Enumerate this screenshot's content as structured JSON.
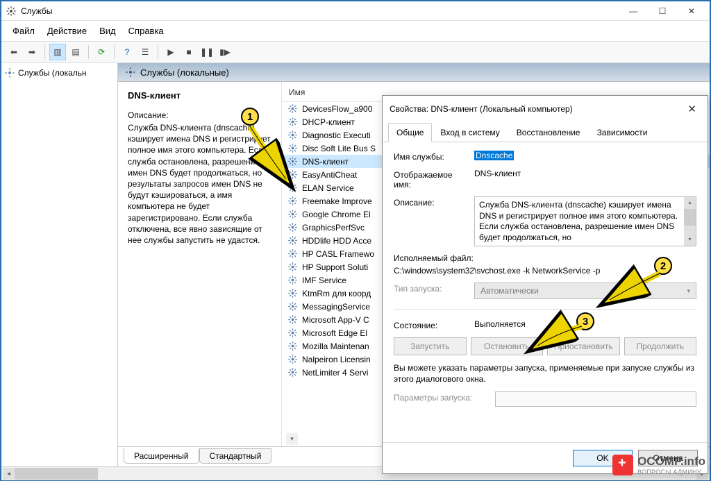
{
  "window": {
    "title": "Службы"
  },
  "menu": {
    "file": "Файл",
    "action": "Действие",
    "view": "Вид",
    "help": "Справка"
  },
  "nav": {
    "local_services": "Службы (локальн"
  },
  "center": {
    "header": "Службы (локальные)",
    "selected_name": "DNS-клиент",
    "desc_label": "Описание:",
    "desc_text": "Служба DNS-клиента (dnscache) кэширует имена DNS и регистрирует полное имя этого компьютера. Если служба остановлена, разрешение имен DNS будет продолжаться, но результаты запросов имен DNS не будут кэшироваться, а имя компьютера не будет зарегистрировано. Если служба отключена, все явно зависящие от нее службы запустить не удастся.",
    "column_name": "Имя",
    "tabs": {
      "extended": "Расширенный",
      "standard": "Стандартный"
    },
    "items": [
      "DevicesFlow_a900",
      "DHCP-клиент",
      "Diagnostic Executi",
      "Disc Soft Lite Bus S",
      "DNS-клиент",
      "EasyAntiCheat",
      "ELAN Service",
      "Freemake Improve",
      "Google Chrome El",
      "GraphicsPerfSvc",
      "HDDlife HDD Acce",
      "HP CASL Framewo",
      "HP Support Soluti",
      "IMF Service",
      "KtmRm для коорд",
      "MessagingService",
      "Microsoft App-V C",
      "Microsoft Edge El",
      "Mozilla Maintenan",
      "Nalpeiron Licensin",
      "NetLimiter 4 Servi"
    ],
    "selected_index": 4
  },
  "dialog": {
    "title": "Свойства: DNS-клиент (Локальный компьютер)",
    "tabs": {
      "general": "Общие",
      "logon": "Вход в систему",
      "recovery": "Восстановление",
      "deps": "Зависимости"
    },
    "labels": {
      "service_name": "Имя службы:",
      "display_name": "Отображаемое имя:",
      "description": "Описание:",
      "exe": "Исполняемый файл:",
      "startup": "Тип запуска:",
      "state": "Состояние:",
      "params": "Параметры запуска:"
    },
    "values": {
      "service_name": "Dnscache",
      "display_name": "DNS-клиент",
      "description": "Служба DNS-клиента (dnscache) кэширует имена DNS и регистрирует полное имя этого компьютера. Если служба остановлена, разрешение имен DNS будет продолжаться, но",
      "exe": "C:\\windows\\system32\\svchost.exe -k NetworkService -p",
      "startup": "Автоматически",
      "state": "Выполняется"
    },
    "buttons": {
      "start": "Запустить",
      "stop": "Остановить",
      "pause": "Приостановить",
      "resume": "Продолжить"
    },
    "hint": "Вы можете указать параметры запуска, применяемые при запуске службы из этого диалогового окна.",
    "footer": {
      "ok": "OK",
      "cancel": "Отмена"
    }
  },
  "callouts": {
    "1": "1",
    "2": "2",
    "3": "3"
  },
  "watermark": {
    "brand": "OCOMP.info",
    "sub": "ВОПРОСЫ АДМИНУ"
  }
}
